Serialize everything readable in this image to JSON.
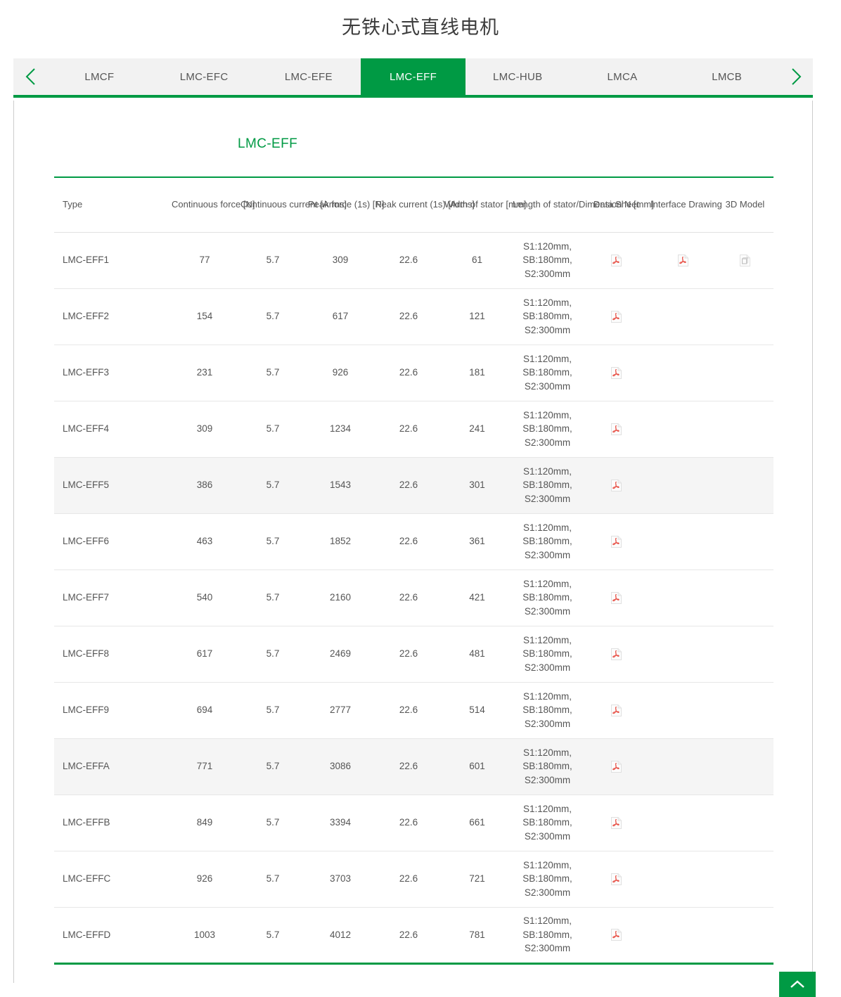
{
  "header": {
    "title": "无铁心式直线电机"
  },
  "tabs": {
    "prev_icon": "chevron-left-icon",
    "next_icon": "chevron-right-icon",
    "items": [
      {
        "label": "LMCF",
        "active": false
      },
      {
        "label": "LMC-EFC",
        "active": false
      },
      {
        "label": "LMC-EFE",
        "active": false
      },
      {
        "label": "LMC-EFF",
        "active": true
      },
      {
        "label": "LMC-HUB",
        "active": false
      },
      {
        "label": "LMCA",
        "active": false
      },
      {
        "label": "LMCB",
        "active": false
      }
    ]
  },
  "section": {
    "title": "LMC-EFF",
    "accent_color": "#009A44"
  },
  "table": {
    "columns": [
      "Type",
      "Continuous force [N]",
      "Continuous current [Arms]",
      "Peak force (1s) [N]",
      "Peak current (1s) [Arms]",
      "Width of stator [mm]",
      "Length of stator/Dimension N [mm]",
      "Data Sheet",
      "Interface Drawing",
      "3D Model"
    ],
    "icon_names": {
      "pdf": "pdf-file-icon",
      "model": "3d-model-file-icon"
    },
    "rows": [
      {
        "type": "LMC-EFF1",
        "cont_force": "77",
        "cont_current": "5.7",
        "peak_force": "309",
        "peak_current": "22.6",
        "width": "61",
        "length": "S1:120mm,\nSB:180mm,\nS2:300mm",
        "data_sheet": true,
        "interface_drawing": true,
        "model_3d": true,
        "shaded": false
      },
      {
        "type": "LMC-EFF2",
        "cont_force": "154",
        "cont_current": "5.7",
        "peak_force": "617",
        "peak_current": "22.6",
        "width": "121",
        "length": "S1:120mm,\nSB:180mm,\nS2:300mm",
        "data_sheet": true,
        "interface_drawing": false,
        "model_3d": false,
        "shaded": false
      },
      {
        "type": "LMC-EFF3",
        "cont_force": "231",
        "cont_current": "5.7",
        "peak_force": "926",
        "peak_current": "22.6",
        "width": "181",
        "length": "S1:120mm,\nSB:180mm,\nS2:300mm",
        "data_sheet": true,
        "interface_drawing": false,
        "model_3d": false,
        "shaded": false
      },
      {
        "type": "LMC-EFF4",
        "cont_force": "309",
        "cont_current": "5.7",
        "peak_force": "1234",
        "peak_current": "22.6",
        "width": "241",
        "length": "S1:120mm,\nSB:180mm,\nS2:300mm",
        "data_sheet": true,
        "interface_drawing": false,
        "model_3d": false,
        "shaded": false
      },
      {
        "type": "LMC-EFF5",
        "cont_force": "386",
        "cont_current": "5.7",
        "peak_force": "1543",
        "peak_current": "22.6",
        "width": "301",
        "length": "S1:120mm,\nSB:180mm,\nS2:300mm",
        "data_sheet": true,
        "interface_drawing": false,
        "model_3d": false,
        "shaded": true
      },
      {
        "type": "LMC-EFF6",
        "cont_force": "463",
        "cont_current": "5.7",
        "peak_force": "1852",
        "peak_current": "22.6",
        "width": "361",
        "length": "S1:120mm,\nSB:180mm,\nS2:300mm",
        "data_sheet": true,
        "interface_drawing": false,
        "model_3d": false,
        "shaded": false
      },
      {
        "type": "LMC-EFF7",
        "cont_force": "540",
        "cont_current": "5.7",
        "peak_force": "2160",
        "peak_current": "22.6",
        "width": "421",
        "length": "S1:120mm,\nSB:180mm,\nS2:300mm",
        "data_sheet": true,
        "interface_drawing": false,
        "model_3d": false,
        "shaded": false
      },
      {
        "type": "LMC-EFF8",
        "cont_force": "617",
        "cont_current": "5.7",
        "peak_force": "2469",
        "peak_current": "22.6",
        "width": "481",
        "length": "S1:120mm,\nSB:180mm,\nS2:300mm",
        "data_sheet": true,
        "interface_drawing": false,
        "model_3d": false,
        "shaded": false
      },
      {
        "type": "LMC-EFF9",
        "cont_force": "694",
        "cont_current": "5.7",
        "peak_force": "2777",
        "peak_current": "22.6",
        "width": "514",
        "length": "S1:120mm,\nSB:180mm,\nS2:300mm",
        "data_sheet": true,
        "interface_drawing": false,
        "model_3d": false,
        "shaded": false
      },
      {
        "type": "LMC-EFFA",
        "cont_force": "771",
        "cont_current": "5.7",
        "peak_force": "3086",
        "peak_current": "22.6",
        "width": "601",
        "length": "S1:120mm,\nSB:180mm,\nS2:300mm",
        "data_sheet": true,
        "interface_drawing": false,
        "model_3d": false,
        "shaded": true
      },
      {
        "type": "LMC-EFFB",
        "cont_force": "849",
        "cont_current": "5.7",
        "peak_force": "3394",
        "peak_current": "22.6",
        "width": "661",
        "length": "S1:120mm,\nSB:180mm,\nS2:300mm",
        "data_sheet": true,
        "interface_drawing": false,
        "model_3d": false,
        "shaded": false
      },
      {
        "type": "LMC-EFFC",
        "cont_force": "926",
        "cont_current": "5.7",
        "peak_force": "3703",
        "peak_current": "22.6",
        "width": "721",
        "length": "S1:120mm,\nSB:180mm,\nS2:300mm",
        "data_sheet": true,
        "interface_drawing": false,
        "model_3d": false,
        "shaded": false
      },
      {
        "type": "LMC-EFFD",
        "cont_force": "1003",
        "cont_current": "5.7",
        "peak_force": "4012",
        "peak_current": "22.6",
        "width": "781",
        "length": "S1:120mm,\nSB:180mm,\nS2:300mm",
        "data_sheet": true,
        "interface_drawing": false,
        "model_3d": false,
        "shaded": false
      }
    ]
  },
  "scroll_top": {
    "icon": "chevron-up-icon"
  }
}
